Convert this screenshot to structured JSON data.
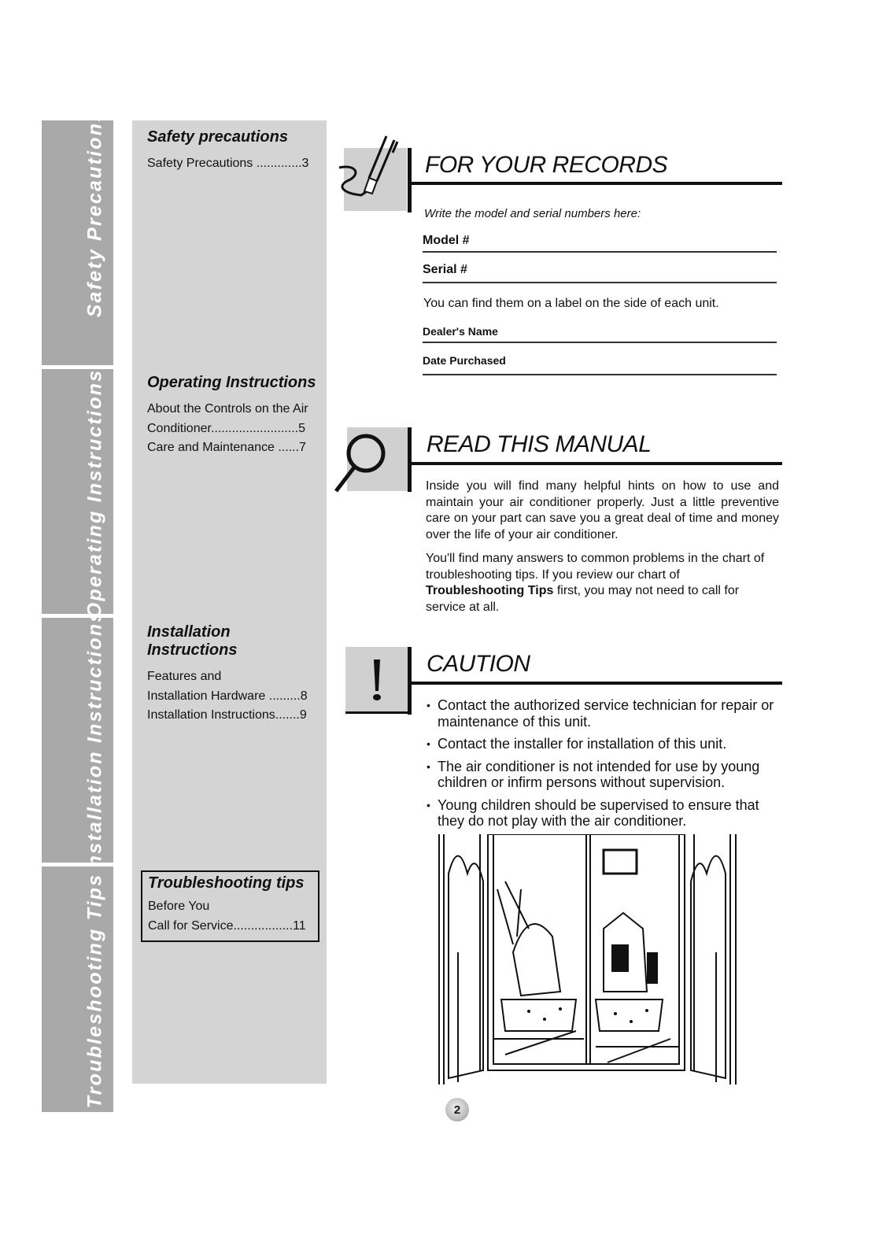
{
  "side_tabs": [
    {
      "label": "Safety Precautions"
    },
    {
      "label": "Operating Instructions"
    },
    {
      "label": "Installation Instructions"
    },
    {
      "label": "Troubleshooting Tips"
    }
  ],
  "toc": {
    "sections": [
      {
        "heading": "Safety precautions",
        "lines": [
          "Safety Precautions .............3"
        ]
      },
      {
        "heading": "Operating Instructions",
        "lines": [
          "About the Controls on the Air",
          "Conditioner.........................5",
          "Care and Maintenance  ......7"
        ]
      },
      {
        "heading": "Installation Instructions",
        "lines": [
          "Features and",
          "Installation Hardware .........8",
          "Installation Instructions.......9"
        ]
      },
      {
        "heading": "Troubleshooting tips",
        "lines": [
          "Before You",
          "Call for Service.................11"
        ]
      }
    ]
  },
  "records": {
    "title": "FOR YOUR RECORDS",
    "icon": "pen-writing-icon",
    "instruction": "Write the model and serial numbers here:",
    "model_label": "Model #",
    "serial_label": "Serial #",
    "label_note": "You can find them on a label on the side of each unit.",
    "dealer_label": "Dealer's Name",
    "date_label": "Date Purchased"
  },
  "read_manual": {
    "title": "READ THIS MANUAL",
    "icon": "magnifying-glass-icon",
    "para1": "Inside you will find many helpful hints on how to use and maintain your air conditioner properly. Just a little preventive care on your part can save you a great deal of time and money over the life of your air conditioner.",
    "para2_pre": "You'll find many answers to common problems in the chart of troubleshooting tips. If you review our chart of ",
    "para2_bold": "Troubleshooting Tips",
    "para2_post": " first, you may not need to call for service at all."
  },
  "caution": {
    "title": "CAUTION",
    "icon": "exclamation-icon",
    "bullets": [
      "Contact the authorized service technician for repair or maintenance of this unit.",
      "Contact the installer for installation of this unit.",
      "The air conditioner is not intended for use by young children or infirm persons without supervision.",
      "Young children should be supervised to ensure that they do not play with the air conditioner."
    ]
  },
  "illustration": {
    "description": "window-view-living-room-illustration"
  },
  "page_number": "2"
}
